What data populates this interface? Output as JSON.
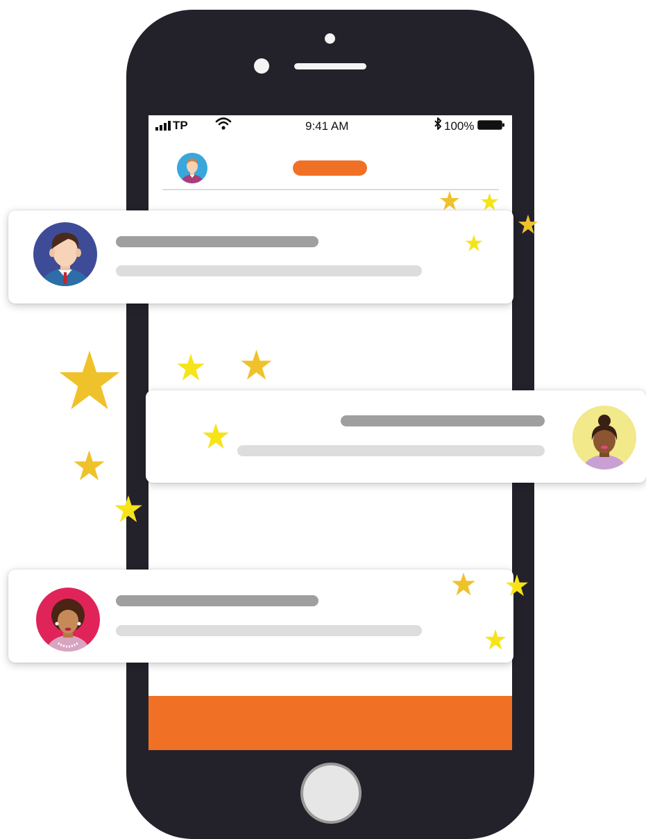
{
  "status_bar": {
    "carrier": "TP",
    "time": "9:41 AM",
    "battery": "100%"
  },
  "colors": {
    "accent": "#f07125",
    "phone_body": "#23222b",
    "star_gold": "#efc22b",
    "star_yellow": "#f6e418"
  },
  "icons": {
    "signal": "signal-icon",
    "wifi": "wifi-icon",
    "bluetooth": "bluetooth-icon",
    "battery": "battery-icon"
  }
}
